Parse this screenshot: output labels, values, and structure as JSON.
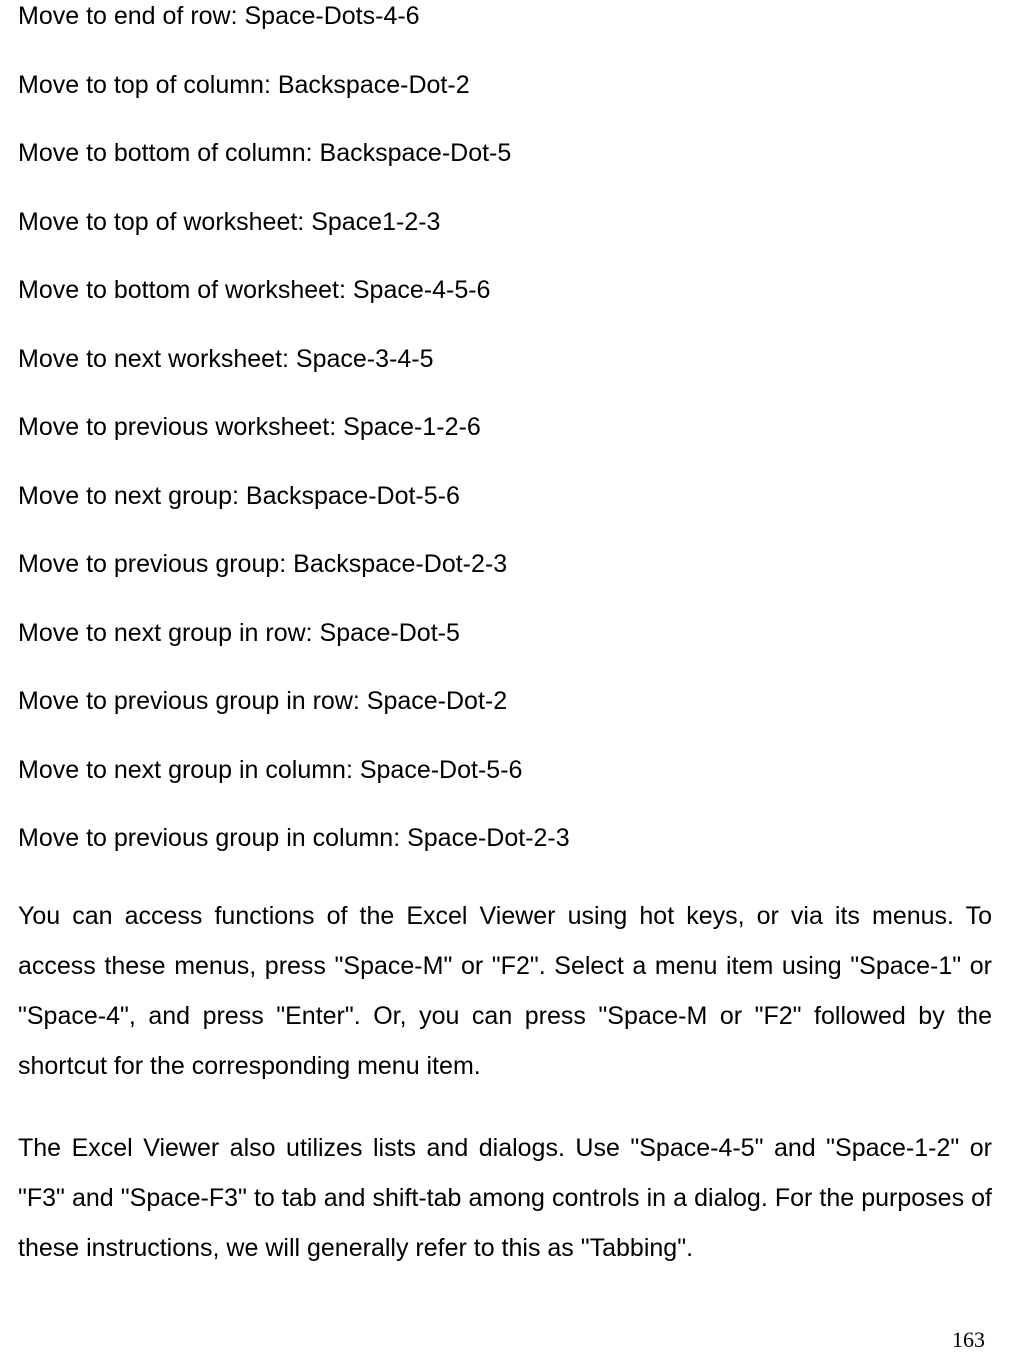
{
  "lines": [
    "Move to end of row: Space-Dots-4-6",
    "Move to top of column: Backspace-Dot-2",
    "Move to bottom of column: Backspace-Dot-5",
    "Move to top of worksheet: Space1-2-3",
    "Move to bottom of worksheet: Space-4-5-6",
    "Move to next worksheet: Space-3-4-5",
    "Move to previous worksheet: Space-1-2-6",
    "Move to next group: Backspace-Dot-5-6",
    "Move to previous group: Backspace-Dot-2-3",
    "Move to next group in row: Space-Dot-5",
    "Move to previous group in row: Space-Dot-2",
    "Move to next group in column: Space-Dot-5-6",
    "Move to previous group in column: Space-Dot-2-3"
  ],
  "paragraphs": [
    "You can access functions of the Excel Viewer using hot keys, or via its menus. To access these menus, press \"Space-M\" or \"F2\". Select a menu item using \"Space-1\" or \"Space-4\", and press \"Enter\". Or, you can press \"Space-M or \"F2\" followed by the shortcut for the corresponding menu item.",
    "The Excel Viewer also utilizes lists and dialogs. Use \"Space-4-5\" and \"Space-1-2\" or \"F3\" and \"Space-F3\" to tab and shift-tab among controls in a dialog. For the purposes of these instructions, we will generally refer to this as \"Tabbing\"."
  ],
  "pageNumber": "163"
}
